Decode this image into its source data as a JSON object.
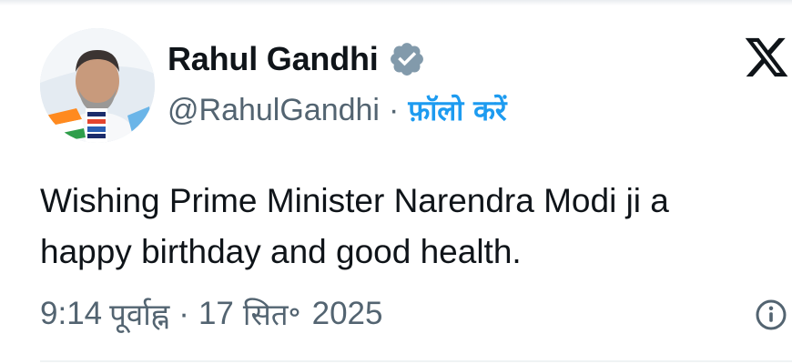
{
  "author": {
    "display_name": "Rahul Gandhi",
    "handle": "@RahulGandhi",
    "verified": true,
    "verified_color": "#829aab"
  },
  "follow": {
    "separator": "·",
    "label": "फ़ॉलो करें",
    "color": "#1d9bf0"
  },
  "tweet": {
    "text": "Wishing Prime Minister Narendra Modi ji a\nhappy birthday and good health."
  },
  "meta": {
    "time": "9:14",
    "period": "पूर्वाह्न",
    "separator": "·",
    "date_day": "17",
    "date_month": "सित॰",
    "date_year": "2025"
  },
  "icons": {
    "brand": "x-logo-icon",
    "verified": "verified-badge-icon",
    "info": "info-icon"
  }
}
